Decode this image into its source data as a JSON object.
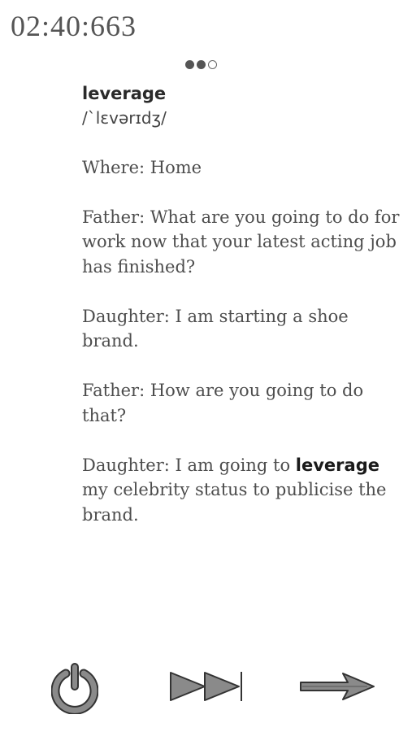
{
  "timer": "02:40:663",
  "pager": {
    "current": 2,
    "total": 3
  },
  "card": {
    "word": "leverage",
    "phonetic": "/ˋlɛvərɪdʒ/",
    "where": "Where: Home",
    "lines": [
      "Father: What are you going to do for work now that your latest acting job has finished?",
      "Daughter: I am starting a shoe brand.",
      "Father: How are you going to do that?"
    ],
    "last_line": {
      "before": "Daughter: I am going to ",
      "highlight": "leverage",
      "after": " my celebrity status to publicise the brand."
    }
  },
  "controls": {
    "power_icon": "power-icon",
    "skip_icon": "skip-forward-icon",
    "next_icon": "arrow-right-icon"
  },
  "colors": {
    "icon_fill": "#8a8a8a",
    "icon_stroke": "#333333",
    "text": "#4d4d4d"
  }
}
